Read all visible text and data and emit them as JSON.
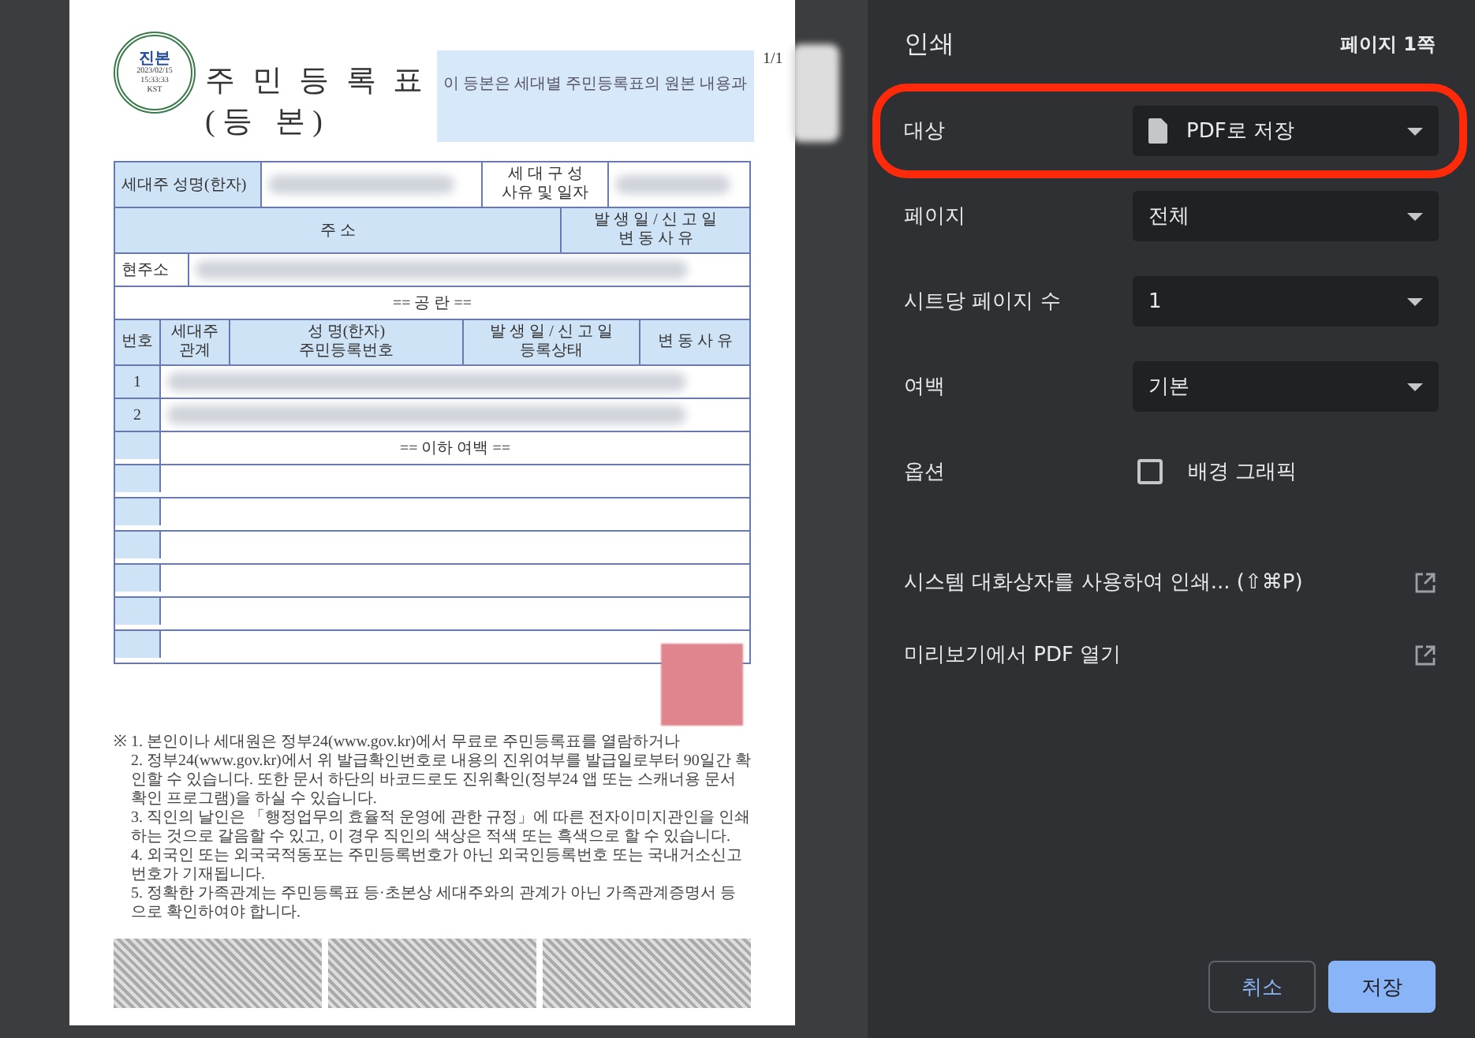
{
  "preview": {
    "page_counter": "1/1",
    "stamp": {
      "label": "진본",
      "date": "2023/02/15",
      "time": "15:33:33",
      "zone": "KST"
    },
    "title": "주 민 등 록 표",
    "subtitle": "( 등   본 )",
    "notice": "이 등본은 세대별 주민등록표의 원본 내용과",
    "household": {
      "head_label": "세대주 성명(한자)",
      "composition_lines": [
        "세 대 구 성",
        "사유 및 일자"
      ]
    },
    "address": {
      "header": "주     소",
      "date_lines": [
        "발 생 일 / 신 고 일",
        "변   동   사   유"
      ],
      "current_label": "현주소",
      "blank_note": "== 공 란 =="
    },
    "members": {
      "columns": [
        {
          "lines": [
            "번호"
          ]
        },
        {
          "lines": [
            "세대주",
            "관계"
          ]
        },
        {
          "lines": [
            "성  명(한자)",
            "주민등록번호"
          ]
        },
        {
          "lines": [
            "발 생 일 / 신 고 일",
            "등록상태"
          ]
        },
        {
          "lines": [
            "변 동 사 유"
          ]
        }
      ],
      "rows": [
        {
          "number": "1"
        },
        {
          "number": "2"
        }
      ],
      "end_note": "== 이하 여백 =="
    },
    "footnote_mark": "※",
    "footnotes": [
      "1. 본인이나 세대원은 정부24(www.gov.kr)에서 무료로 주민등록표를 열람하거나",
      "2. 정부24(www.gov.kr)에서 위 발급확인번호로 내용의 진위여부를 발급일로부터 90일간 확인할 수 있습니다. 또한 문서 하단의 바코드로도 진위확인(정부24 앱 또는 스캐너용 문서확인 프로그램)을 하실 수 있습니다.",
      "3. 직인의 날인은 「행정업무의 효율적 운영에 관한 규정」에 따른 전자이미지관인을 인쇄하는 것으로 갈음할 수 있고, 이 경우 직인의 색상은 적색 또는 흑색으로 할 수 있습니다.",
      "4. 외국인 또는 외국국적동포는 주민등록번호가 아닌 외국인등록번호 또는 국내거소신고번호가 기재됩니다.",
      "5. 정확한 가족관계는 주민등록표 등·초본상 세대주와의 관계가 아닌 가족관계증명서 등으로 확인하여야 합니다."
    ]
  },
  "panel": {
    "title": "인쇄",
    "page_count": "페이지 1쪽",
    "settings": [
      {
        "kind": "destination",
        "label": "대상",
        "value": "PDF로 저장",
        "highlighted": true
      },
      {
        "kind": "select",
        "label": "페이지",
        "value": "전체",
        "highlighted": false
      },
      {
        "kind": "select",
        "label": "시트당 페이지 수",
        "value": "1",
        "highlighted": false
      },
      {
        "kind": "select",
        "label": "여백",
        "value": "기본",
        "highlighted": false
      },
      {
        "kind": "checkbox",
        "label": "옵션",
        "value": "배경 그래픽",
        "checked": false,
        "highlighted": false
      }
    ],
    "links": [
      {
        "label": "시스템 대화상자를 사용하여 인쇄... (⇧⌘P)"
      },
      {
        "label": "미리보기에서 PDF 열기"
      }
    ],
    "buttons": [
      {
        "label": "취소",
        "kind": "secondary"
      },
      {
        "label": "저장",
        "kind": "primary"
      }
    ]
  }
}
